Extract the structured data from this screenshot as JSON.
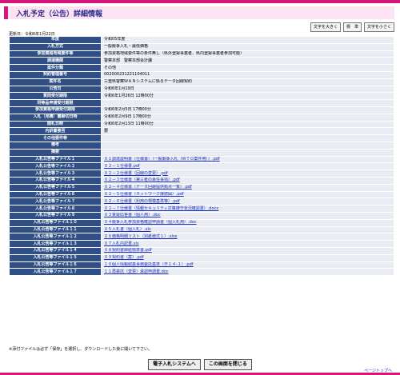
{
  "page": {
    "title": "入札予定（公告）詳細情報",
    "updated": "更新日：令和6年1月22日",
    "note": "※添付ファイルは必ず「保存」を選択し、ダウンロードした後に開いて下さい。",
    "page_top": "ページトップへ"
  },
  "font_buttons": {
    "large": "文字を大きく",
    "standard": "標　準",
    "small": "文字を小さく"
  },
  "rows": [
    {
      "label": "年度",
      "value": "令和05年度"
    },
    {
      "label": "入札方式",
      "value": "一般競争入札・最低価格"
    },
    {
      "label": "参加資格地域要件等",
      "value": "参加資格地域要件等の条件無し（県外登録事業者、県内登録事業者参加可能）"
    },
    {
      "label": "調達機関",
      "value": "警察本部　警察本部会計課"
    },
    {
      "label": "案件分類",
      "value": "その他"
    },
    {
      "label": "契約管理番号",
      "value": "002000231221104011"
    },
    {
      "label": "案件名",
      "value": "三重県警察ＷＡＮシステムに係るデータ回線契約"
    },
    {
      "label": "公告日",
      "value": "令和6年1月19日"
    },
    {
      "label": "質問受付期限",
      "value": "令和6年1月26日 12時00分"
    },
    {
      "label": "同等品申請受付期限",
      "value": ""
    },
    {
      "label": "参加資格申請受付期限",
      "value": "令和6年2月5日 17時00分"
    },
    {
      "label": "入札（見積）書締切日時",
      "value": "令和6年2月9日 17時00分"
    },
    {
      "label": "開札日時",
      "value": "令和6年2月13日 11時00分"
    },
    {
      "label": "内訳書要否",
      "value": "要"
    },
    {
      "label": "その他要件等",
      "value": ""
    },
    {
      "label": "備考",
      "value": ""
    },
    {
      "label": "摘要",
      "value": ""
    },
    {
      "label": "入札公告等ファイル１",
      "value": "０１調達説明書（仕様書）（一般競争入札（ＷＴＯ案件用））.pdf",
      "link": true
    },
    {
      "label": "入札公告等ファイル２",
      "value": "０２－１仕様書.pdf",
      "link": true
    },
    {
      "label": "入札公告等ファイル３",
      "value": "０２－２仕様書（回線の変更）.pdf",
      "link": true
    },
    {
      "label": "入札公告等ファイル４",
      "value": "０２－３仕様書（第三者の責任事項）.pdf",
      "link": true
    },
    {
      "label": "入札公告等ファイル５",
      "value": "０２－４仕様書（データ回線提供拠点一覧）.pdf",
      "link": true
    },
    {
      "label": "入札公告等ファイル６",
      "value": "０２－５仕様書（ネットワーク接続図）.pdf",
      "link": true
    },
    {
      "label": "入札公告等ファイル７",
      "value": "０２－６仕様書（利用の規模基準等）.pdf",
      "link": true
    },
    {
      "label": "入札公告等ファイル８",
      "value": "０２－７仕様書（情報セキュリティ対策遵守状況確認書）.docx",
      "link": true
    },
    {
      "label": "入札公告等ファイル９",
      "value": "０３質疑応答書（個人用）.doc",
      "link": true
    },
    {
      "label": "入札公告等ファイル１０",
      "value": "０４競争入札参加資格確認申請書（個入札用）.doc",
      "link": true
    },
    {
      "label": "入札公告等ファイル１１",
      "value": "０５入札書（個入札）.xls",
      "link": true
    },
    {
      "label": "入札公告等ファイル１２",
      "value": "０６価格明細リスト（別紙様式１）.xlsx",
      "link": true
    },
    {
      "label": "入札公告等ファイル１３",
      "value": "０７入札内訳書.xls",
      "link": true
    },
    {
      "label": "入札公告等ファイル１４",
      "value": "０８契約書締結標準書.pdf",
      "link": true
    },
    {
      "label": "入札公告等ファイル１５",
      "value": "０９契約書（案）.pdf",
      "link": true
    },
    {
      "label": "入札公告等ファイル１６",
      "value": "１０個人情報取扱事務委託基準（不１４-１）.pdf",
      "link": true
    },
    {
      "label": "入札公告等ファイル１７",
      "value": "１１再委託（変更）承認申請書.doc",
      "link": true
    }
  ],
  "actions": {
    "system": "電子入札システムへ",
    "close": "この画面を閉じる"
  }
}
